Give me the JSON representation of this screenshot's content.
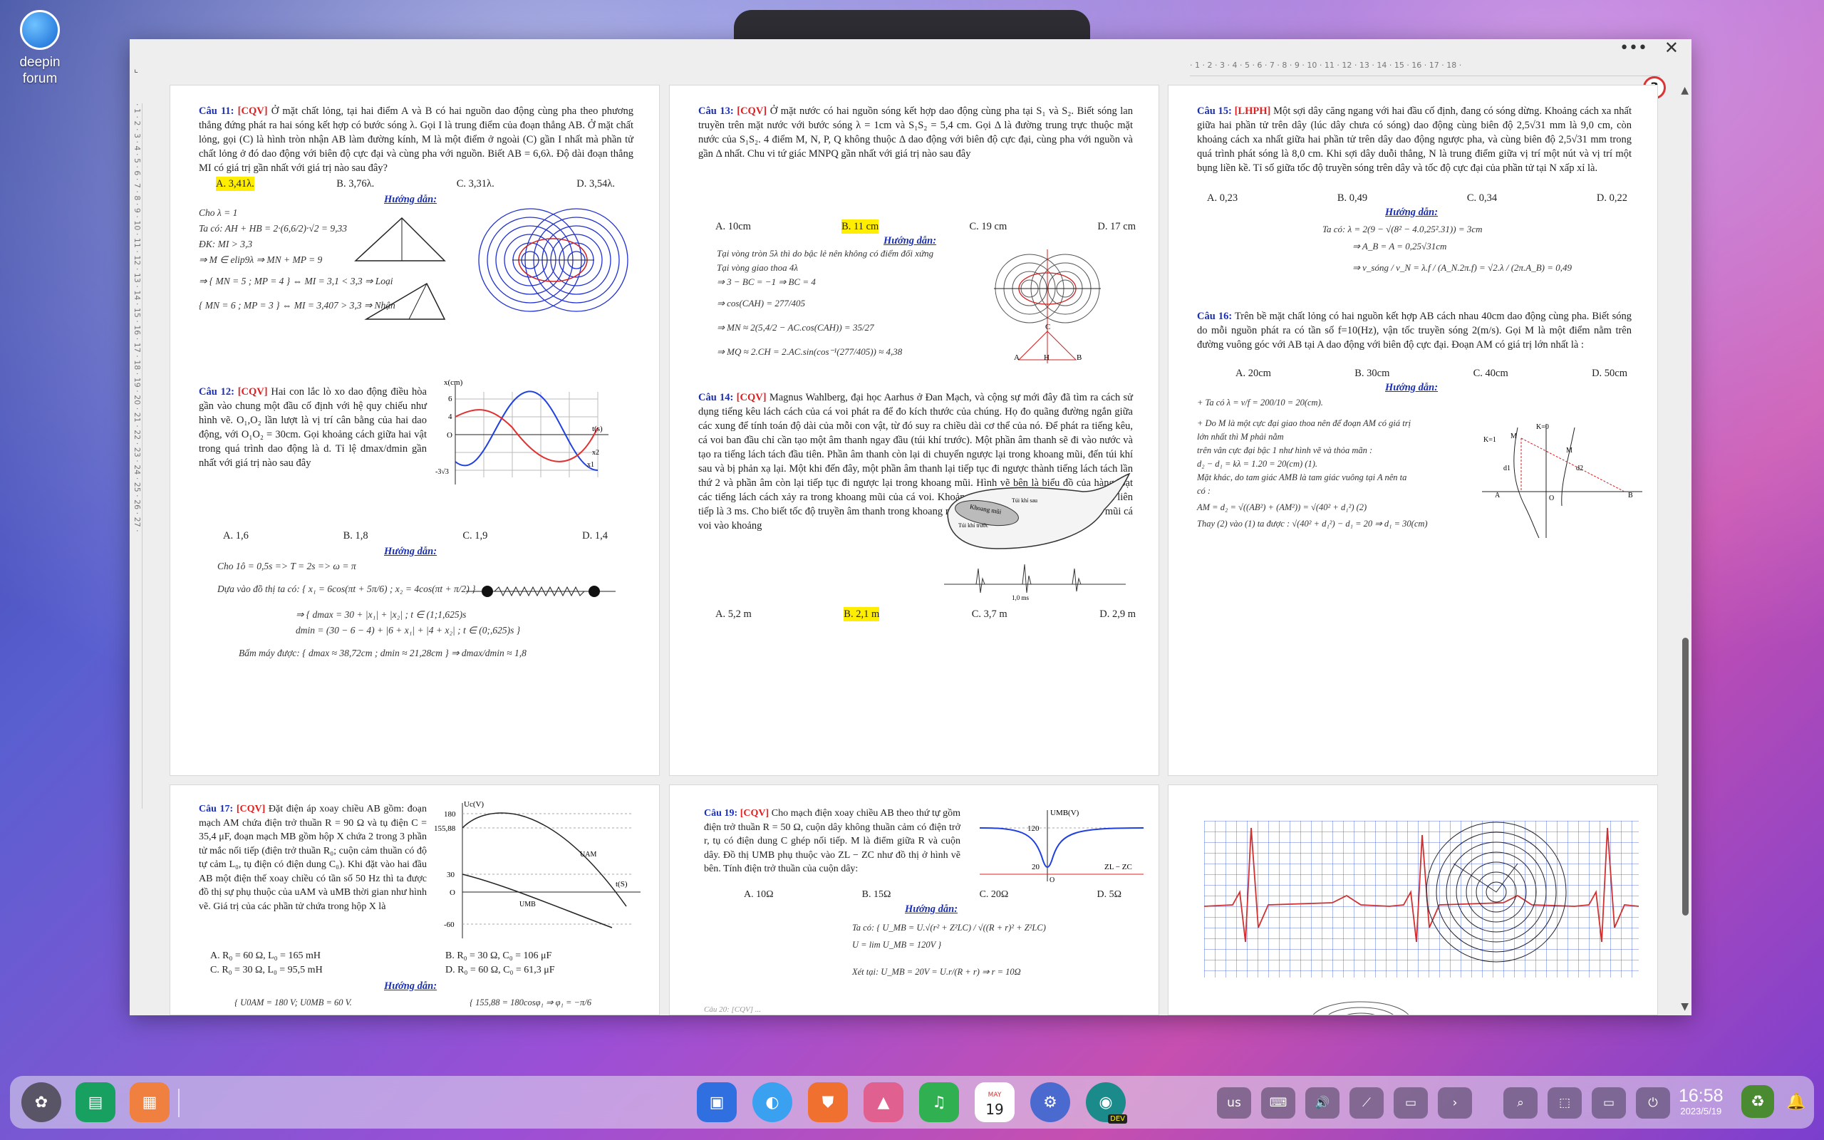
{
  "desktop": {
    "icon_label_1": "deepin",
    "icon_label_2": "forum"
  },
  "window": {
    "ruler_numbers": "· 1 · 2 · 3 · 4 · 5 · 6 · 7 · 8 · 9 · 10 · 11 · 12 · 13 · 14 · 15 · 16 · 17 · 18 ·",
    "vruler_numbers": "· 1 · 2 · 3 · 4 · 5 · 6 · 7 · 8 · 9 · 10 · 11 · 12 · 13 · 14 · 15 · 16 · 17 · 18 · 19 · 20 · 21 · 22 · 23 · 24 · 25 · 26 · 27 ·",
    "page_badge": "3"
  },
  "page1": {
    "q11_num": "Câu 11:",
    "q11_tag": "[CQV]",
    "q11_text": "Ở mặt chất lỏng, tại hai điểm A và B có hai nguồn dao động cùng pha theo phương thẳng đứng phát ra hai sóng kết hợp có bước sóng λ. Gọi I là trung điểm của đoạn thẳng AB. Ở mặt chất lỏng, gọi (C) là hình tròn nhận AB làm đường kính, M là một điểm ở ngoài (C) gần I nhất mà phần tử chất lỏng ở đó dao động với biên độ cực đại và cùng pha với nguồn. Biết AB = 6,6λ. Độ dài đoạn thẳng MI có giá trị gần nhất với giá trị nào sau đây?",
    "q11_opts": [
      "A. 3,41λ.",
      "B. 3,76λ.",
      "C. 3,31λ.",
      "D. 3,54λ."
    ],
    "guide": "Hướng dẫn:",
    "q11_math": [
      "Cho λ = 1",
      "Ta có: AH + HB = 2·(6,6/2)·√2 = 9,33",
      "ĐK: MI > 3,3",
      "⇒ M ∈ elip9λ ⇒ MN + MP = 9",
      "⇒ { MN = 5 ; MP = 4 } ⇔ MI = 3,1 < 3,3 ⇒ Loại",
      "   { MN = 6 ; MP = 3 } ⇔ MI = 3,407 > 3,3 ⇒ Nhận"
    ],
    "q12_num": "Câu 12:",
    "q12_tag": "[CQV]",
    "q12_text": "Hai con lắc lò xo dao động điều hòa gần vào chung một đầu cố định với hệ quy chiếu như hình vẽ. O₁,O₂ lần lượt là vị trí cân bằng của hai dao động, với O₁O₂ = 30cm. Gọi khoảng cách giữa hai vật trong quá trình dao động là d. Tỉ lệ dmax/dmin gần nhất với giá trị nào sau đây",
    "q12_opts": [
      "A. 1,6",
      "B. 1,8",
      "C. 1,9",
      "D. 1,4"
    ],
    "q12_math": [
      "Cho 1ô = 0,5s => T = 2s => ω = π",
      "Dựa vào đồ thị ta có: { x₁ = 6cos(πt + 5π/6) ; x₂ = 4cos(πt + π/2) }",
      "⇒ { dmax = 30 + |x₁| + |x₂| ; t ∈ (1;1,625)s",
      "    dmin = (30 − 6 − 4) + |6 + x₁| + |4 + x₂| ; t ∈ (0;,625)s }",
      "Bấm máy được: { dmax ≈ 38,72cm ; dmin ≈ 21,28cm } ⇒ dmax/dmin ≈ 1,8"
    ],
    "graph_labels": {
      "x_axis": "t(s)",
      "y_axis": "x(cm)",
      "y6": "6",
      "y4": "4",
      "y0": "O",
      "neg": "-3√3",
      "x1": "x1",
      "x2": "x2"
    }
  },
  "page2": {
    "q13_num": "Câu 13:",
    "q13_tag": "[CQV]",
    "q13_text": "Ở mặt nước có hai nguồn sóng kết hợp dao động cùng pha tại S₁ và S₂. Biết sóng lan truyền trên mặt nước với bước sóng λ = 1cm và S₁S₂ = 5,4 cm. Gọi Δ là đường trung trực thuộc mặt nước của S₁S₂. 4 điểm M, N, P, Q không thuộc Δ dao động với biên độ cực đại, cùng pha với nguồn và gần Δ nhất. Chu vi tứ giác MNPQ gần nhất với giá trị nào sau đây",
    "q13_opts": [
      "A. 10cm",
      "B. 11 cm",
      "C. 19 cm",
      "D. 17 cm"
    ],
    "q13_math": [
      "Tại vòng tròn 5λ thì do bậc lẻ nên không có điểm đối xứng",
      "Tại vòng giao thoa 4λ",
      "⇒ 3 − BC = −1 ⇒ BC = 4",
      "⇒ cos(CAH) = 277/405",
      "⇒ MN ≈ 2(5,4/2 − AC.cos(CAH)) = 35/27",
      "⇒ MQ ≈ 2.CH = 2.AC.sin(cos⁻¹(277/405)) ≈ 4,38"
    ],
    "q14_num": "Câu 14:",
    "q14_tag": "[CQV]",
    "q14_text": "Magnus Wahlberg, đại học Aarhus ở Đan Mạch, và cộng sự mới đây đã tìm ra cách sử dụng tiếng kêu lách cách của cá voi phát ra để đo kích thước của chúng. Họ đo quãng đường ngắn giữa các xung để tính toán độ dài của mỗi con vật, từ đó suy ra chiều dài cơ thể của nó. Để phát ra tiếng kêu, cá voi ban đầu chỉ cần tạo một âm thanh ngay đầu (túi khí trước). Một phần âm thanh sẽ đi vào nước và tạo ra tiếng lách tách đầu tiên. Phần âm thanh còn lại di chuyển ngược lại trong khoang mũi, đến túi khí sau và bị phản xạ lại. Một khi đến đây, một phần âm thanh lại tiếp tục đi ngược thành tiếng lách tách lần thứ 2 và phần âm còn lại tiếp tục đi ngược lại trong khoang mũi. Hình vẽ bên là biểu đồ của hàng loạt các tiếng lách cách xảy ra trong khoang mũi của cá voi. Khoảng thời gian giữa hai tiếng lách cách liên tiếp là 3 ms. Cho biết tốc độ truyền âm thanh trong khoang mũi cá voi là 1372 m/s. Chiều dài của mũi cá voi vào khoảng",
    "q14_opts": [
      "A. 5,2 m",
      "B. 2,1 m",
      "C. 3,7 m",
      "D. 2,9 m"
    ],
    "whale_labels": {
      "nose": "Khoang mũi",
      "back": "Túi khí sau",
      "front": "Túi khí trước",
      "scale": "1,0 ms"
    },
    "q13_fig_labels": {
      "c": "C",
      "a": "A",
      "h": "H",
      "b": "B"
    }
  },
  "page3": {
    "q15_num": "Câu 15:",
    "q15_tag": "[LHPH]",
    "q15_text": "Một sợi dây căng ngang với hai đầu cố định, đang có sóng dừng. Khoảng cách xa nhất giữa hai phần tử trên dây (lúc dây chưa có sóng) dao động cùng biên độ 2,5√31 mm là 9,0 cm, còn khoảng cách xa nhất giữa hai phần tử trên dây dao động ngược pha, và cùng biên độ 2,5√31 mm trong quá trình phát sóng là 8,0 cm. Khi sợi dây duỗi thẳng, N là trung điểm giữa vị trí một nút và vị trí một bụng liền kề. Tỉ số giữa tốc độ truyền sóng trên dây và tốc độ cực đại của phần tử tại N xấp xỉ là.",
    "q15_opts": [
      "A. 0,23",
      "B. 0,49",
      "C. 0,34",
      "D. 0,22"
    ],
    "q15_math": [
      "Ta có: λ = 2(9 − √(8² − 4.0,25².31)) = 3cm",
      "⇒ A_B = A = 0,25√31cm",
      "⇒ v_sóng / v_N = λ.f / (A_N.2π.f) = √2.λ / (2π.A_B) = 0,49"
    ],
    "q16_num": "Câu 16:",
    "q16_tag": "",
    "q16_text": "Trên bề mặt chất lỏng có hai nguồn kết hợp AB cách nhau 40cm dao động cùng pha. Biết sóng do mỗi nguồn phát ra có tần số f=10(Hz), vận tốc truyền sóng 2(m/s). Gọi M là một điểm nằm trên đường vuông góc với AB tại A dao động với biên độ cực đại. Đoạn AM có giá trị lớn nhất là :",
    "q16_opts": [
      "A. 20cm",
      "B. 30cm",
      "C. 40cm",
      "D. 50cm"
    ],
    "q16_math": [
      "+ Ta có  λ = v/f = 200/10 = 20(cm).",
      "+ Do M là một cực đại giao thoa nên để đoạn AM có giá trị",
      "lớn nhất thì M phải nằm",
      "trên vân cực đại bậc 1 như hình vẽ và thỏa mãn :",
      "d₂ − d₁ = kλ = 1.20 = 20(cm) (1).",
      "Mặt khác, do tam giác AMB là tam giác vuông tại A nên ta",
      "có :",
      "AM = d₂ = √((AB²) + (AM²)) = √(40² + d₁²) (2)",
      "Thay (2) vào (1) ta được : √(40² + d₁²) − d₁ = 20 ⇒ d₁ = 30(cm)"
    ],
    "q16_fig_labels": {
      "k0": "K=0",
      "k1": "K=1",
      "m": "M",
      "d1": "d1",
      "d2": "d2",
      "a": "A",
      "b": "B",
      "o": "O"
    }
  },
  "page4": {
    "q17_num": "Câu 17:",
    "q17_tag": "[CQV]",
    "q17_text": "Đặt điện áp xoay chiều AB gồm: đoạn mạch AM chứa điện trở thuần R = 90 Ω và tụ điện C = 35,4 μF, đoạn mạch MB gồm hộp X chứa 2 trong 3 phần tử mắc nối tiếp (điện trở thuần R₀; cuộn cảm thuần có độ tự cảm L₀, tụ điện có điện dung C₀). Khi đặt vào hai đầu AB một điện thế xoay chiều có tần số 50 Hz thì ta được đồ thị sự phụ thuộc của uAM và uMB thời gian như hình vẽ. Giá trị của các phần tử chứa trong hộp X là",
    "q17_opts": [
      "A. R₀ = 60 Ω, L₀ = 165 mH",
      "B. R₀ = 30 Ω, C₀ = 106 μF",
      "C. R₀ = 30 Ω, L₀ = 95,5 mH",
      "D. R₀ = 60 Ω, C₀ = 61,3 μF"
    ],
    "q17_math": [
      "{ U0AM = 180 V; U0MB = 60 V.",
      "{ 155,88 = 180cosφ₁ ⇒ φ₁ = −π/6"
    ],
    "q17_graph": {
      "y_axis": "Uc(V)",
      "y180": "180",
      "y155": "155,88",
      "y30": "30",
      "y0": "O",
      "yneg": "-60",
      "x_axis": "t(S)",
      "uam": "UAM",
      "umb": "UMB"
    }
  },
  "page5": {
    "q19_num": "Câu 19:",
    "q19_tag": "[CQV]",
    "q19_text": "Cho mạch điện xoay chiều AB theo thứ tự gồm điện trở thuần R = 50 Ω, cuộn dây không thuần cảm có điện trở r, tụ có điện dung C ghép nối tiếp. M là điểm giữa R và cuộn dây. Đồ thị UMB phụ thuộc vào ZL − ZC như đồ thị ở hình vẽ bên. Tính điện trở thuần của cuộn dây:",
    "q19_opts": [
      "A. 10Ω",
      "B. 15Ω",
      "C. 20Ω",
      "D. 5Ω"
    ],
    "q19_math": [
      "Ta có: { U_MB = U.√(r² + Z²LC) / √((R + r)² + Z²LC)",
      "         U = lim U_MB = 120V }",
      "Xét tại: U_MB = 20V = U.r/(R + r) ⇒ r = 10Ω"
    ],
    "q19_graph": {
      "y_axis": "UMB(V)",
      "y120": "120",
      "y20": "20",
      "x_axis": "ZL − ZC",
      "o": "O"
    },
    "footer_hint": "Câu 20: [CQV] ..."
  },
  "dock": {
    "apps": [
      "launcher",
      "multitasking",
      "desktop",
      "file-manager",
      "browser",
      "app-store",
      "image-viewer",
      "music",
      "calendar",
      "settings",
      "edge-dev"
    ],
    "calendar_day": "19",
    "calendar_month": "MAY",
    "edge_badge": "DEV",
    "tray": [
      "us",
      "keyboard",
      "volume",
      "network",
      "battery",
      "more",
      "search",
      "screenshot",
      "display",
      "power"
    ],
    "time": "16:58",
    "date": "2023/5/19"
  }
}
